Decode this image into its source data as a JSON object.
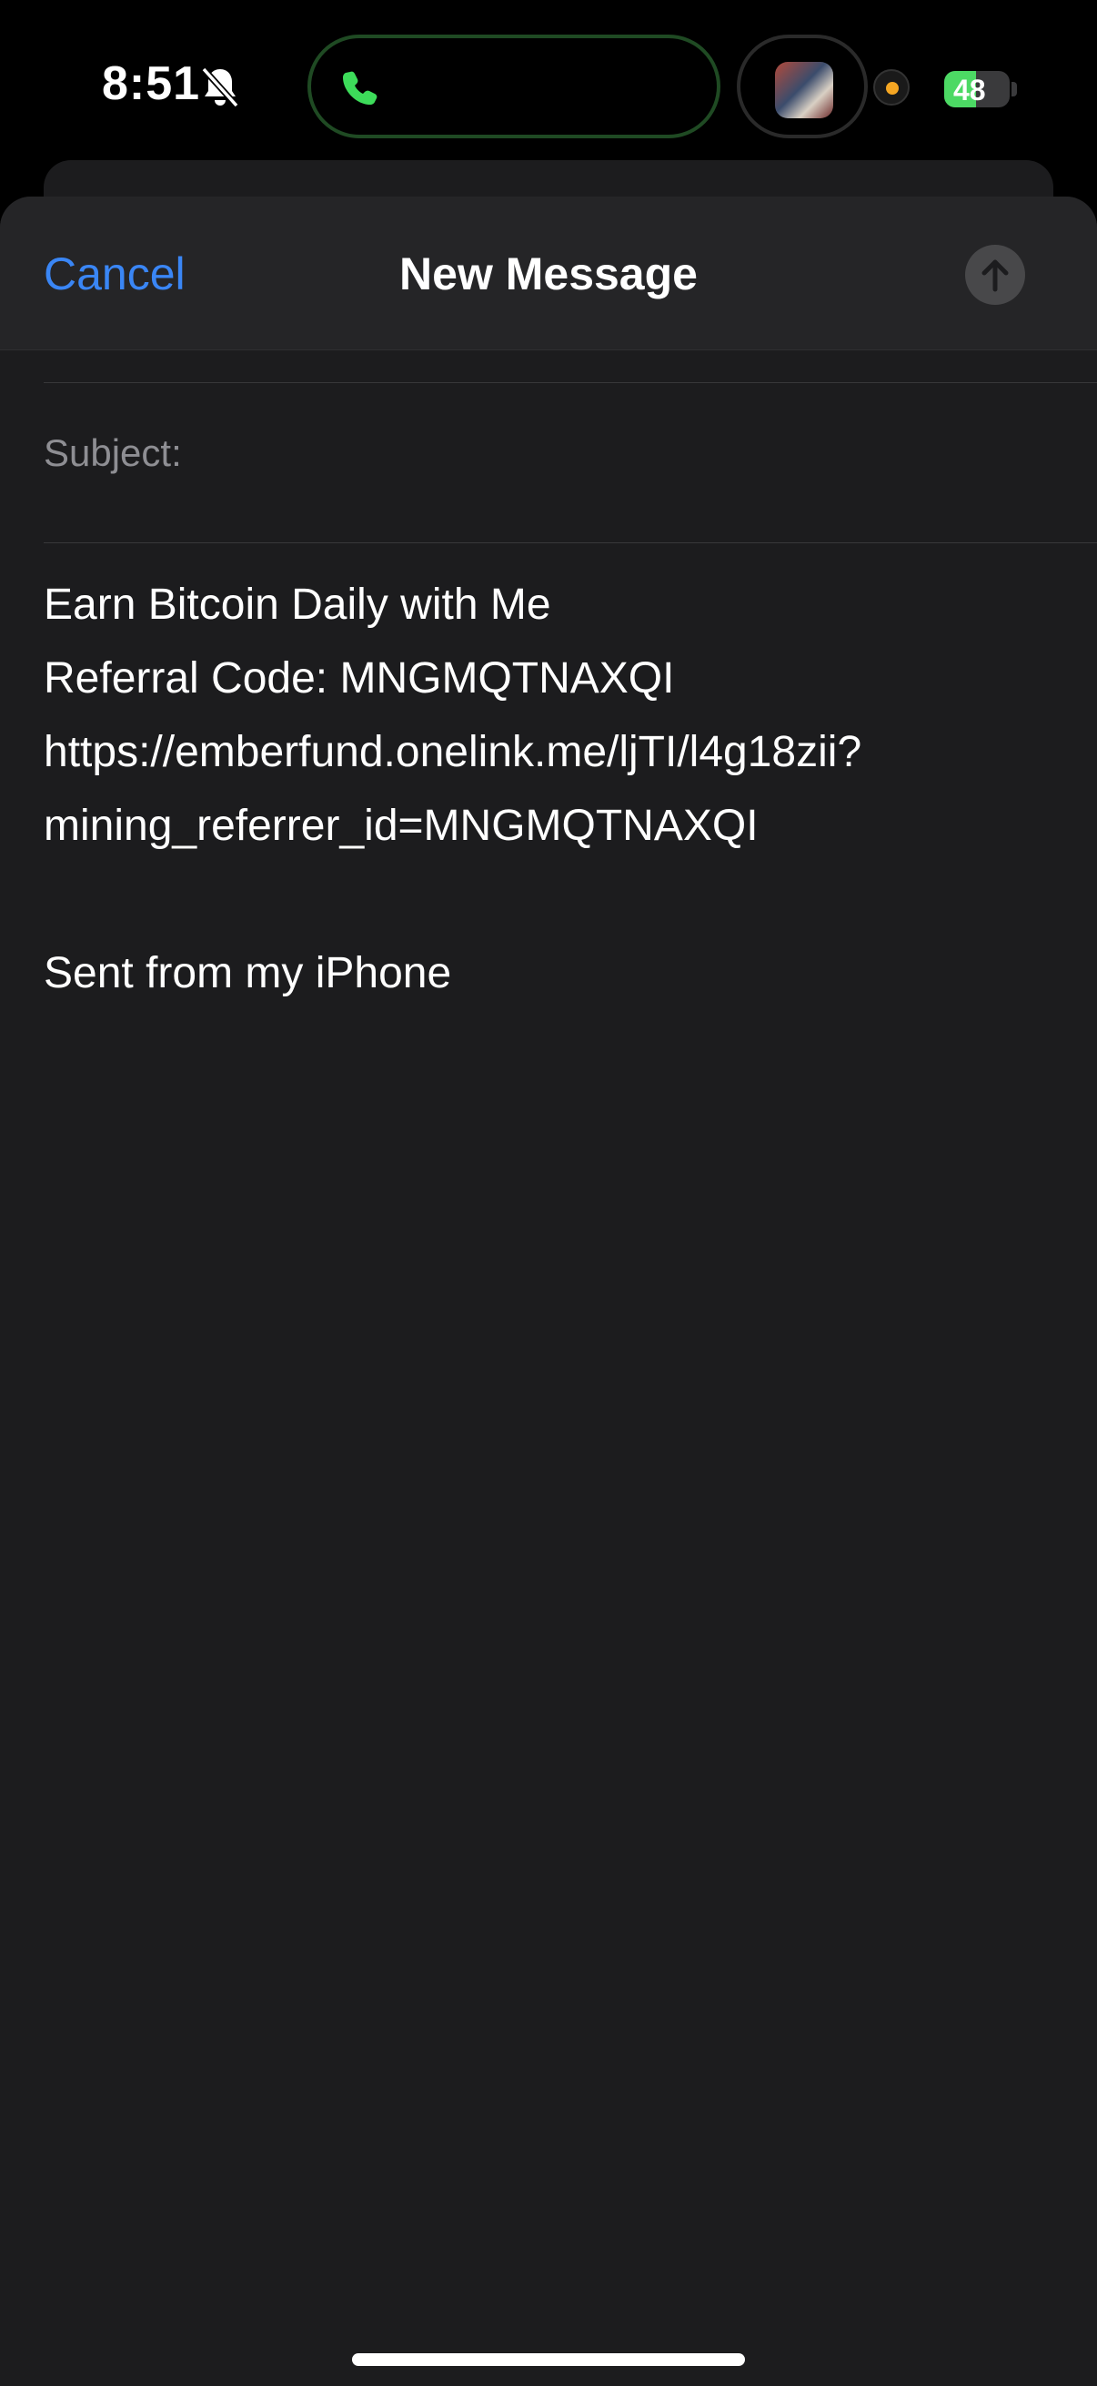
{
  "status_bar": {
    "time": "8:51",
    "battery_level": "48",
    "battery_fraction": 0.48,
    "icons": [
      "bell-slash-icon",
      "phone-icon",
      "media-thumbnail",
      "recording-dot-icon",
      "battery-charging-icon"
    ]
  },
  "compose": {
    "cancel_label": "Cancel",
    "title": "New Message",
    "subject_label": "Subject:",
    "body_lines": [
      "Earn Bitcoin Daily with Me",
      "Referral Code: MNGMQTNAXQI",
      "https://emberfund.onelink.me/ljTI/l4g18zii?",
      "mining_referrer_id=MNGMQTNAXQI",
      "",
      "Sent from my iPhone"
    ]
  },
  "colors": {
    "accent": "#3a86f5",
    "background": "#1c1c1e",
    "nav_background": "#252527",
    "battery_green": "#4cd964",
    "recording_dot": "#f5a623"
  }
}
